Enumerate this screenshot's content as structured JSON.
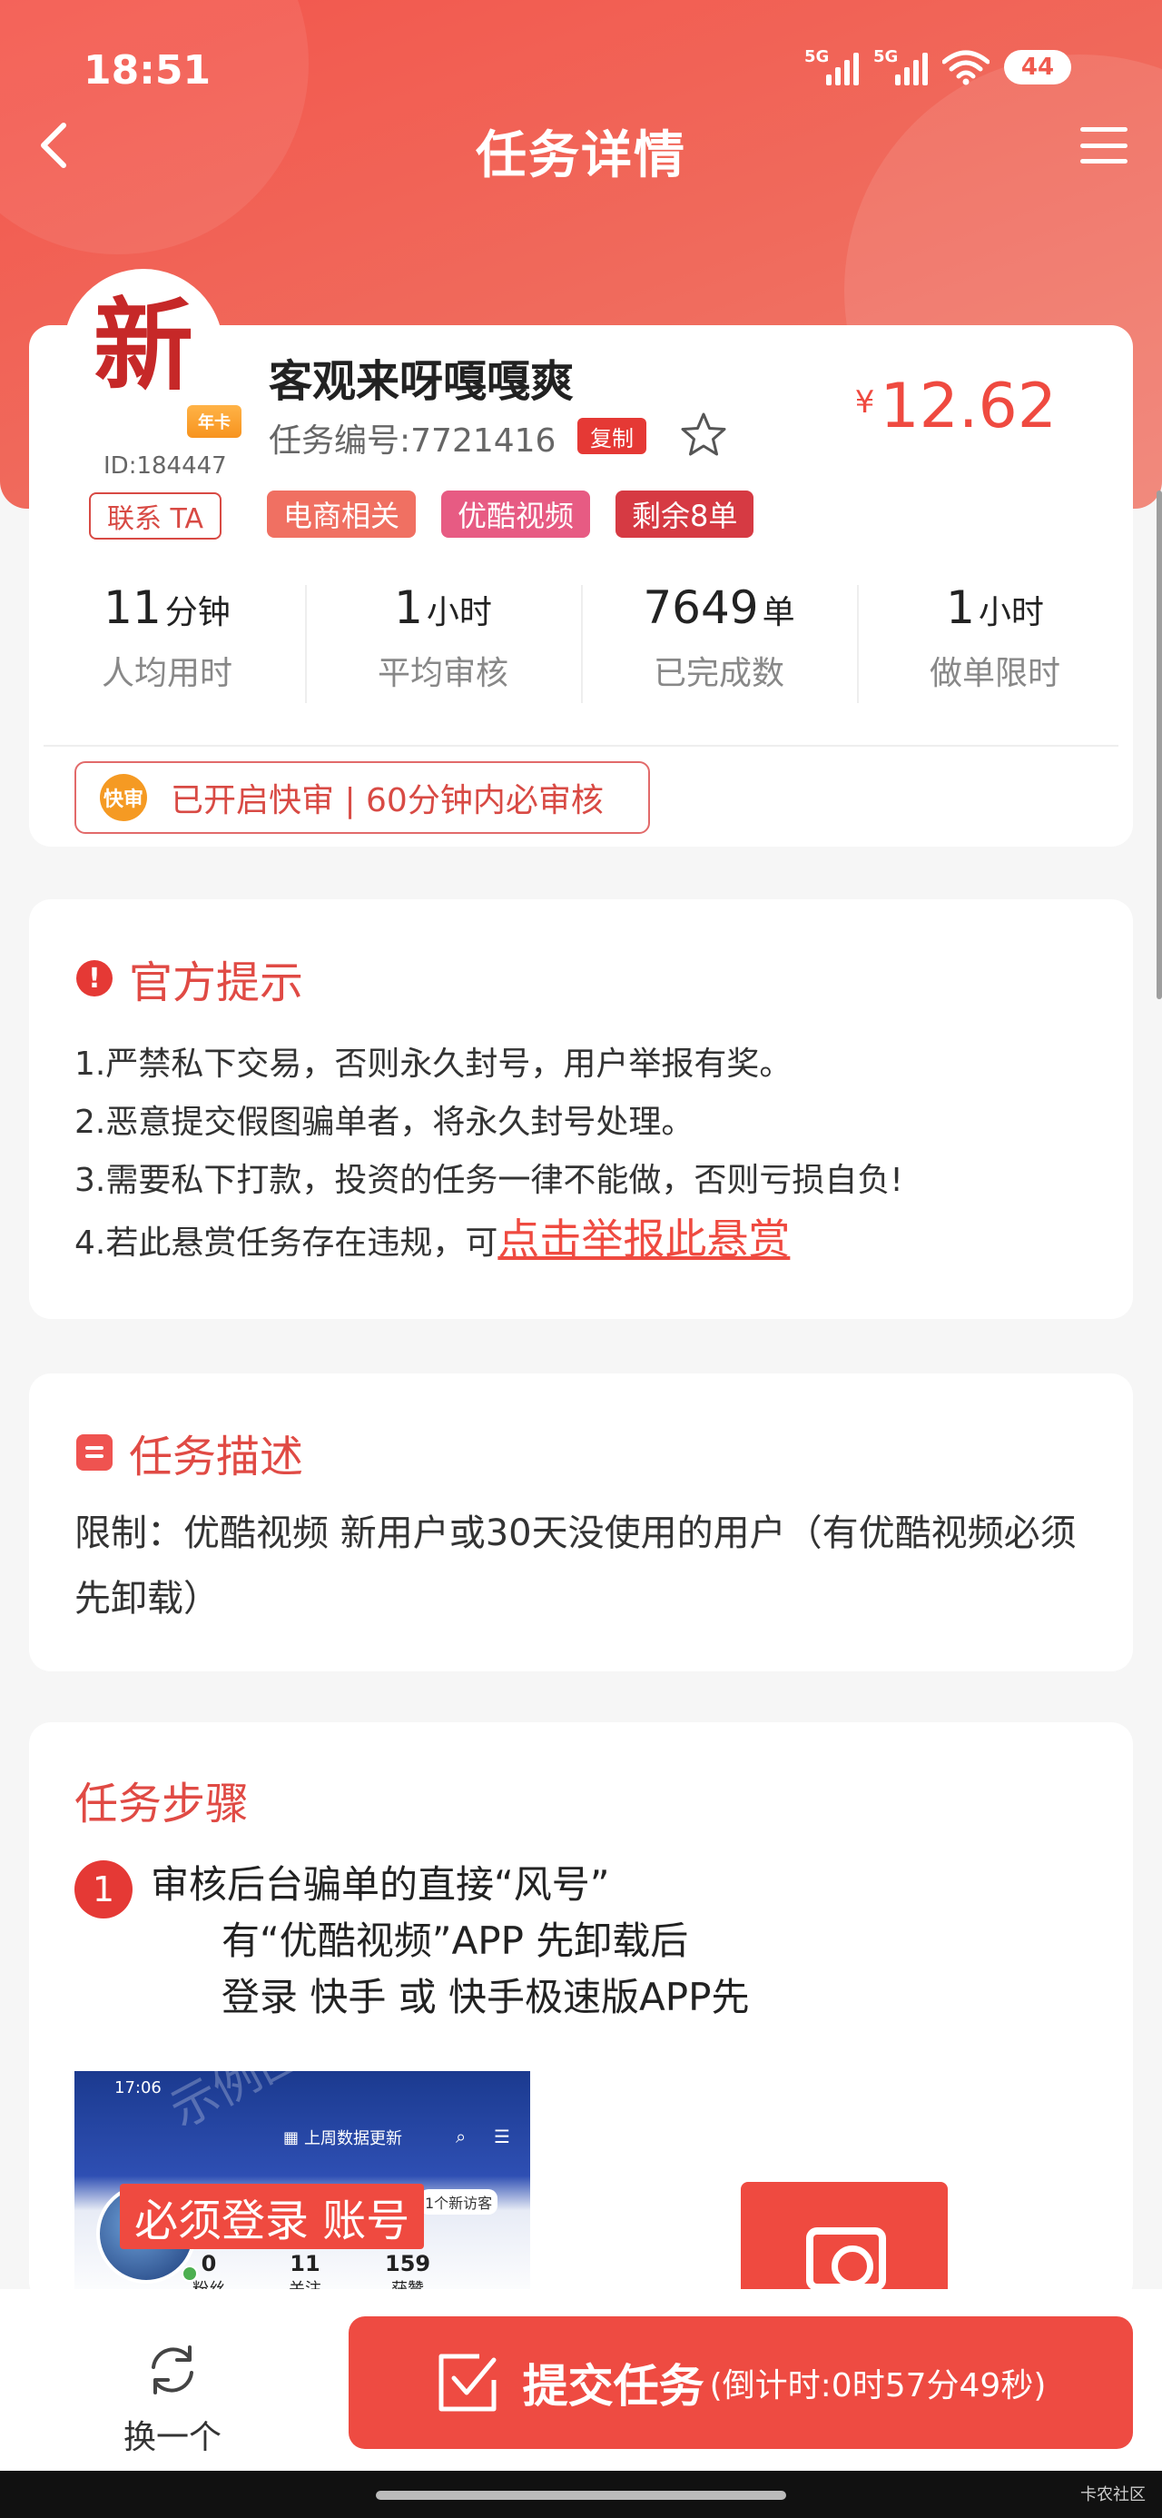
{
  "status": {
    "time": "18:51",
    "signal1": "5G",
    "signal2": "5G",
    "battery": "44"
  },
  "nav": {
    "title": "任务详情",
    "back_icon": "chevron-left-icon",
    "menu_icon": "hamburger-menu-icon"
  },
  "task": {
    "avatar_char": "新",
    "avatar_badge": "年卡",
    "user_id": "ID:184447",
    "contact_label": "联系 TA",
    "name": "客观来呀嘎嘎爽",
    "number": "任务编号:7721416",
    "copy_label": "复制",
    "price_symbol": "¥",
    "price": "12.62",
    "tags": [
      "电商相关",
      "优酷视频",
      "剩余8单"
    ]
  },
  "stats": [
    {
      "value": "11",
      "unit": "分钟",
      "label": "人均用时"
    },
    {
      "value": "1",
      "unit": "小时",
      "label": "平均审核"
    },
    {
      "value": "7649",
      "unit": "单",
      "label": "已完成数"
    },
    {
      "value": "1",
      "unit": "小时",
      "label": "做单限时"
    }
  ],
  "fast_review": {
    "icon_text": "快审",
    "text": "已开启快审 | 60分钟内必审核"
  },
  "notice": {
    "title": "官方提示",
    "items": [
      "1.严禁私下交易，否则永久封号，用户举报有奖。",
      "2.恶意提交假图骗单者，将永久封号处理。",
      "3.需要私下打款，投资的任务一律不能做，否则亏损自负!",
      "4.若此悬赏任务存在违规，可"
    ],
    "report_link": "点击举报此悬赏"
  },
  "description": {
    "title": "任务描述",
    "text": "限制：优酷视频 新用户或30天没使用的用户（有优酷视频必须先卸载）"
  },
  "steps": {
    "title": "任务步骤",
    "step1": {
      "number": "1",
      "lines": [
        "审核后台骗单的直接“风号”",
        "有“优酷视频”APP 先卸载后",
        "登录 快手 或 快手极速版APP先"
      ]
    },
    "screenshot": {
      "time": "17:06",
      "header": "上周数据更新",
      "login_text": "必须登录 账号",
      "visitor": "1个新访客",
      "watermark": "示例图",
      "stats": [
        {
          "n": "0",
          "l": "粉丝"
        },
        {
          "n": "11",
          "l": "关注"
        },
        {
          "n": "159",
          "l": "获赞"
        }
      ]
    }
  },
  "bottom": {
    "swap_label": "换一个",
    "submit_label": "提交任务",
    "countdown": "(倒计时:0时57分49秒)"
  },
  "watermark": "卡农社区",
  "colors": {
    "accent": "#ee4b42",
    "header": "#f3564c"
  }
}
